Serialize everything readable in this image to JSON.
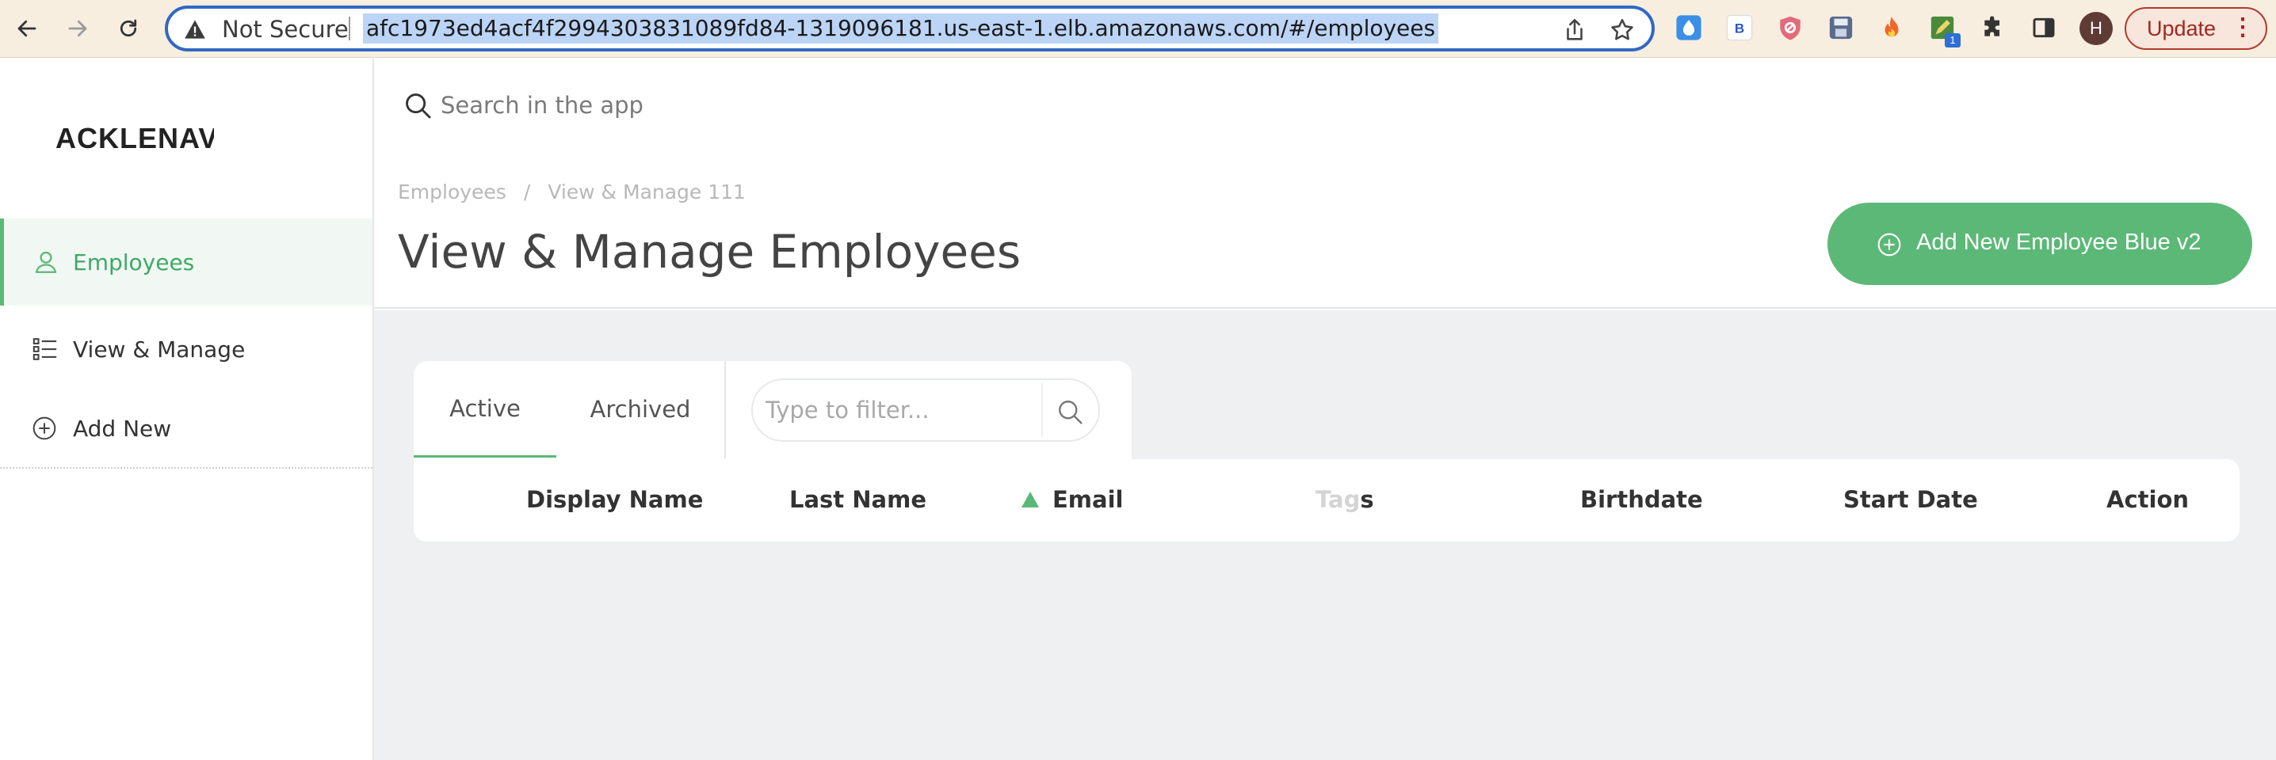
{
  "browser": {
    "security_label": "Not Secure",
    "url": "afc1973ed4acf4f2994303831089fd84-1319096181.us-east-1.elb.amazonaws.com/#/employees",
    "extensions": [
      {
        "name": "droplet-extension-icon"
      },
      {
        "name": "b-extension-icon",
        "text": "B"
      },
      {
        "name": "shield-extension-icon"
      },
      {
        "name": "save-extension-icon"
      },
      {
        "name": "fire-extension-icon"
      },
      {
        "name": "edit-extension-icon",
        "badge": "1"
      },
      {
        "name": "puzzle-extensions-icon"
      },
      {
        "name": "sidepanel-icon"
      }
    ],
    "profile_initial": "H",
    "update_label": "Update",
    "accent": "#3168c4"
  },
  "app": {
    "logo": "ACKLENAVENUE",
    "search_placeholder": "Search in the app",
    "brand_color": "#5cb877"
  },
  "sidebar": {
    "items": [
      {
        "label": "Employees",
        "icon": "user-icon",
        "active": true
      },
      {
        "label": "View & Manage",
        "icon": "list-icon",
        "active": false
      },
      {
        "label": "Add New",
        "icon": "plus-circle-icon",
        "active": false
      }
    ]
  },
  "header": {
    "breadcrumb": [
      "Employees",
      "View & Manage 111"
    ],
    "breadcrumb_separator": "/",
    "title": "View & Manage Employees",
    "add_button_label": "Add New Employee Blue v2"
  },
  "tabs": [
    {
      "label": "Active",
      "active": true
    },
    {
      "label": "Archived",
      "active": false
    }
  ],
  "filter": {
    "placeholder": "Type to filter..."
  },
  "table": {
    "columns": [
      {
        "label": "Display Name"
      },
      {
        "label": "Last Name"
      },
      {
        "label": "Email",
        "sorted": "ascending"
      },
      {
        "label_faded": "Tag",
        "label_rest": "s"
      },
      {
        "label": "Birthdate"
      },
      {
        "label": "Start Date"
      },
      {
        "label": "Action"
      }
    ],
    "rows": []
  }
}
